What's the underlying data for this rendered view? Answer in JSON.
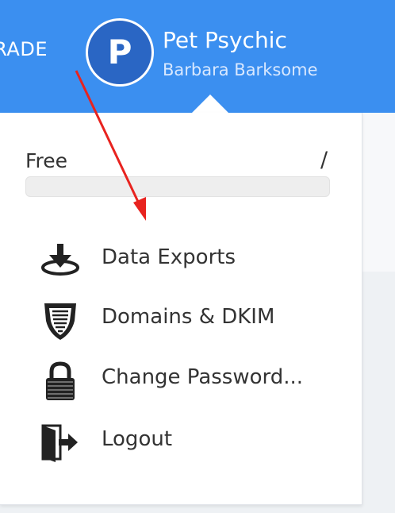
{
  "header": {
    "upgrade_text": "UPGRADE",
    "avatar_initial": "P",
    "org_name": "Pet Psychic",
    "user_name": "Barbara Barksome"
  },
  "plan": {
    "label": "Free",
    "separator": "/",
    "usage_fraction": 0
  },
  "menu": {
    "items": [
      {
        "label": "Data Exports",
        "icon": "download-icon"
      },
      {
        "label": "Domains & DKIM",
        "icon": "shield-icon"
      },
      {
        "label": "Change Password...",
        "icon": "lock-icon"
      },
      {
        "label": "Logout",
        "icon": "logout-icon"
      }
    ]
  },
  "colors": {
    "header_bg": "#3b8ff0",
    "avatar_bg": "#2a66c4",
    "annotation_arrow": "#e8231f"
  }
}
